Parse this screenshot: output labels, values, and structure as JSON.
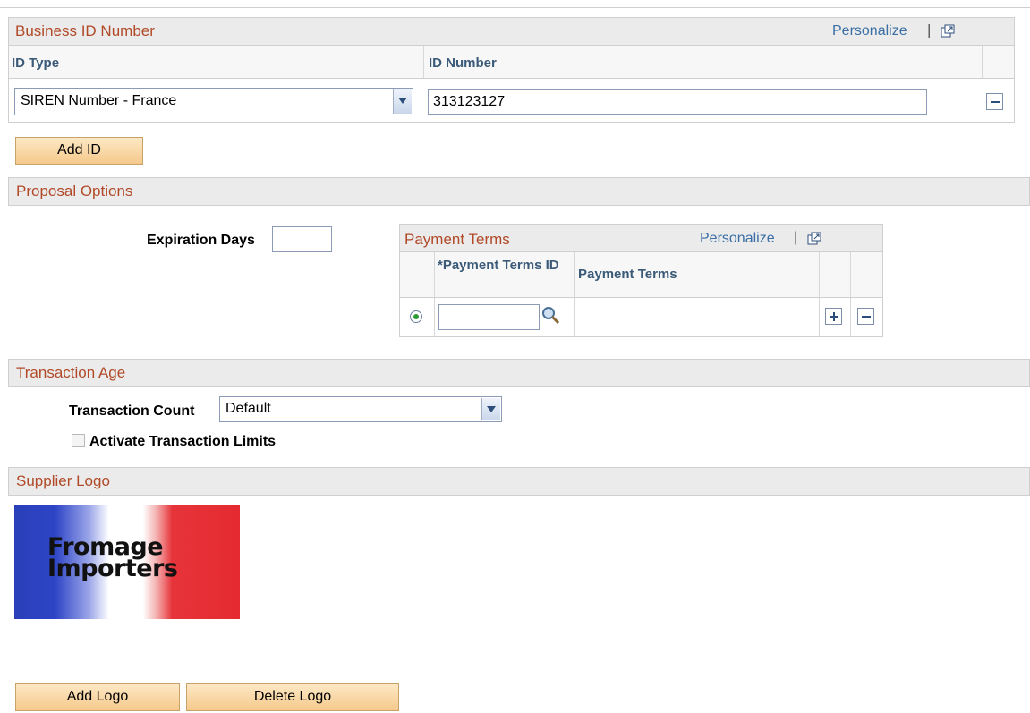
{
  "business_id": {
    "title": "Business ID Number",
    "personalize": "Personalize",
    "col_id_type": "ID Type",
    "col_id_number": "ID Number",
    "row": {
      "id_type": "SIREN Number - France",
      "id_number": "313123127"
    },
    "add_button": "Add ID"
  },
  "proposal": {
    "title": "Proposal Options",
    "expiration_label": "Expiration Days",
    "expiration_value": "",
    "payment_terms": {
      "title": "Payment Terms",
      "personalize": "Personalize",
      "col_id": "*Payment Terms ID",
      "col_terms": "Payment Terms",
      "row_id_value": "",
      "row_terms_value": ""
    }
  },
  "transaction_age": {
    "title": "Transaction Age",
    "count_label": "Transaction Count",
    "count_value": "Default",
    "limits_label": "Activate Transaction Limits",
    "limits_checked": false
  },
  "supplier_logo": {
    "title": "Supplier Logo",
    "logo_text_line1": "Fromage",
    "logo_text_line2": "Importers",
    "add_button": "Add Logo",
    "delete_button": "Delete Logo"
  },
  "colors": {
    "section_title": "#b14a28",
    "link": "#3a6ea5",
    "button_bg": "#f5c98c"
  }
}
